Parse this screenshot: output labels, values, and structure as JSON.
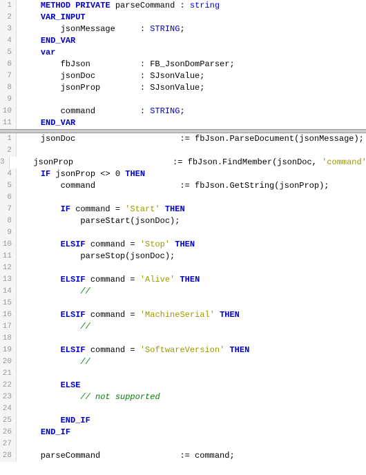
{
  "pane1": {
    "lines": [
      {
        "n": "1",
        "tokens": [
          {
            "t": "    ",
            "c": ""
          },
          {
            "t": "METHOD",
            "c": "kw"
          },
          {
            "t": " ",
            "c": ""
          },
          {
            "t": "PRIVATE",
            "c": "kw"
          },
          {
            "t": " parseCommand : ",
            "c": "ident"
          },
          {
            "t": "string",
            "c": "type"
          }
        ]
      },
      {
        "n": "2",
        "tokens": [
          {
            "t": "    ",
            "c": ""
          },
          {
            "t": "VAR_INPUT",
            "c": "kw"
          }
        ]
      },
      {
        "n": "3",
        "tokens": [
          {
            "t": "        jsonMessage     : ",
            "c": "ident"
          },
          {
            "t": "STRING",
            "c": "type"
          },
          {
            "t": ";",
            "c": "ident"
          }
        ]
      },
      {
        "n": "4",
        "tokens": [
          {
            "t": "    ",
            "c": ""
          },
          {
            "t": "END_VAR",
            "c": "kw"
          }
        ]
      },
      {
        "n": "5",
        "tokens": [
          {
            "t": "    ",
            "c": ""
          },
          {
            "t": "var",
            "c": "kw"
          }
        ]
      },
      {
        "n": "6",
        "tokens": [
          {
            "t": "        fbJson          : FB_JsonDomParser;",
            "c": "ident"
          }
        ]
      },
      {
        "n": "7",
        "tokens": [
          {
            "t": "        jsonDoc         : SJsonValue;",
            "c": "ident"
          }
        ]
      },
      {
        "n": "8",
        "tokens": [
          {
            "t": "        jsonProp        : SJsonValue;",
            "c": "ident"
          }
        ]
      },
      {
        "n": "9",
        "tokens": [
          {
            "t": "",
            "c": ""
          }
        ]
      },
      {
        "n": "10",
        "tokens": [
          {
            "t": "        command         : ",
            "c": "ident"
          },
          {
            "t": "STRING",
            "c": "type"
          },
          {
            "t": ";",
            "c": "ident"
          }
        ]
      },
      {
        "n": "11",
        "tokens": [
          {
            "t": "    ",
            "c": ""
          },
          {
            "t": "END_VAR",
            "c": "kw"
          }
        ]
      }
    ]
  },
  "pane2": {
    "lines": [
      {
        "n": "1",
        "tokens": [
          {
            "t": "    jsonDoc                     := fbJson.ParseDocument(jsonMessage);",
            "c": "ident"
          }
        ]
      },
      {
        "n": "2",
        "tokens": [
          {
            "t": "",
            "c": ""
          }
        ]
      },
      {
        "n": "3",
        "tokens": [
          {
            "t": "    jsonProp                    := fbJson.FindMember(jsonDoc, ",
            "c": "ident"
          },
          {
            "t": "'command'",
            "c": "str"
          },
          {
            "t": ");",
            "c": "ident"
          }
        ]
      },
      {
        "n": "4",
        "tokens": [
          {
            "t": "    ",
            "c": ""
          },
          {
            "t": "IF",
            "c": "kw"
          },
          {
            "t": " jsonProp <> ",
            "c": "ident"
          },
          {
            "t": "0",
            "c": "num"
          },
          {
            "t": " ",
            "c": ""
          },
          {
            "t": "THEN",
            "c": "kw"
          }
        ]
      },
      {
        "n": "5",
        "tokens": [
          {
            "t": "        command                 := fbJson.GetString(jsonProp);",
            "c": "ident"
          }
        ]
      },
      {
        "n": "6",
        "tokens": [
          {
            "t": "",
            "c": ""
          }
        ]
      },
      {
        "n": "7",
        "tokens": [
          {
            "t": "        ",
            "c": ""
          },
          {
            "t": "IF",
            "c": "kw"
          },
          {
            "t": " command = ",
            "c": "ident"
          },
          {
            "t": "'Start'",
            "c": "str"
          },
          {
            "t": " ",
            "c": ""
          },
          {
            "t": "THEN",
            "c": "kw"
          }
        ]
      },
      {
        "n": "8",
        "tokens": [
          {
            "t": "            parseStart(jsonDoc);",
            "c": "ident"
          }
        ]
      },
      {
        "n": "9",
        "tokens": [
          {
            "t": "",
            "c": ""
          }
        ]
      },
      {
        "n": "10",
        "tokens": [
          {
            "t": "        ",
            "c": ""
          },
          {
            "t": "ELSIF",
            "c": "kw"
          },
          {
            "t": " command = ",
            "c": "ident"
          },
          {
            "t": "'Stop'",
            "c": "str"
          },
          {
            "t": " ",
            "c": ""
          },
          {
            "t": "THEN",
            "c": "kw"
          }
        ]
      },
      {
        "n": "11",
        "tokens": [
          {
            "t": "            parseStop(jsonDoc);",
            "c": "ident"
          }
        ]
      },
      {
        "n": "12",
        "tokens": [
          {
            "t": "",
            "c": ""
          }
        ]
      },
      {
        "n": "13",
        "tokens": [
          {
            "t": "        ",
            "c": ""
          },
          {
            "t": "ELSIF",
            "c": "kw"
          },
          {
            "t": " command = ",
            "c": "ident"
          },
          {
            "t": "'Alive'",
            "c": "str"
          },
          {
            "t": " ",
            "c": ""
          },
          {
            "t": "THEN",
            "c": "kw"
          }
        ]
      },
      {
        "n": "14",
        "tokens": [
          {
            "t": "            ",
            "c": ""
          },
          {
            "t": "//",
            "c": "cmt"
          }
        ]
      },
      {
        "n": "15",
        "tokens": [
          {
            "t": "",
            "c": ""
          }
        ]
      },
      {
        "n": "16",
        "tokens": [
          {
            "t": "        ",
            "c": ""
          },
          {
            "t": "ELSIF",
            "c": "kw"
          },
          {
            "t": " command = ",
            "c": "ident"
          },
          {
            "t": "'MachineSerial'",
            "c": "str"
          },
          {
            "t": " ",
            "c": ""
          },
          {
            "t": "THEN",
            "c": "kw"
          }
        ]
      },
      {
        "n": "17",
        "tokens": [
          {
            "t": "            ",
            "c": ""
          },
          {
            "t": "//",
            "c": "cmt"
          }
        ]
      },
      {
        "n": "18",
        "tokens": [
          {
            "t": "",
            "c": ""
          }
        ]
      },
      {
        "n": "19",
        "tokens": [
          {
            "t": "        ",
            "c": ""
          },
          {
            "t": "ELSIF",
            "c": "kw"
          },
          {
            "t": " command = ",
            "c": "ident"
          },
          {
            "t": "'SoftwareVersion'",
            "c": "str"
          },
          {
            "t": " ",
            "c": ""
          },
          {
            "t": "THEN",
            "c": "kw"
          }
        ]
      },
      {
        "n": "20",
        "tokens": [
          {
            "t": "            ",
            "c": ""
          },
          {
            "t": "//",
            "c": "cmt"
          }
        ]
      },
      {
        "n": "21",
        "tokens": [
          {
            "t": "",
            "c": ""
          }
        ]
      },
      {
        "n": "22",
        "tokens": [
          {
            "t": "        ",
            "c": ""
          },
          {
            "t": "ELSE",
            "c": "kw"
          }
        ]
      },
      {
        "n": "23",
        "tokens": [
          {
            "t": "            ",
            "c": ""
          },
          {
            "t": "// not supported",
            "c": "cmt"
          }
        ]
      },
      {
        "n": "24",
        "tokens": [
          {
            "t": "",
            "c": ""
          }
        ]
      },
      {
        "n": "25",
        "tokens": [
          {
            "t": "        ",
            "c": ""
          },
          {
            "t": "END_IF",
            "c": "kw"
          }
        ]
      },
      {
        "n": "26",
        "tokens": [
          {
            "t": "    ",
            "c": ""
          },
          {
            "t": "END_IF",
            "c": "kw"
          }
        ]
      },
      {
        "n": "27",
        "tokens": [
          {
            "t": "",
            "c": ""
          }
        ]
      },
      {
        "n": "28",
        "tokens": [
          {
            "t": "    parseCommand                := command;",
            "c": "ident"
          }
        ]
      }
    ]
  }
}
